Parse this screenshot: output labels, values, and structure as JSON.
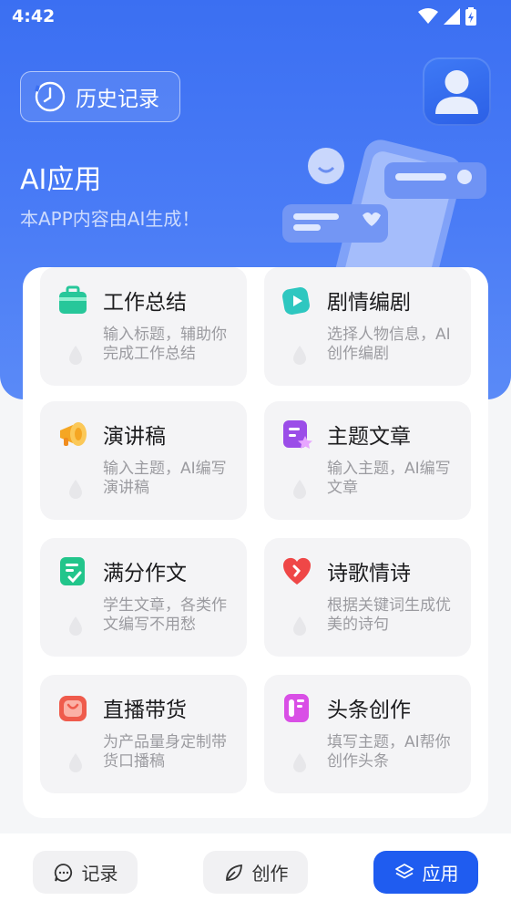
{
  "status_bar": {
    "time": "4:42"
  },
  "header": {
    "history_label": "历史记录",
    "title": "AI应用",
    "subtitle": "本APP内容由AI生成！"
  },
  "apps": [
    {
      "title": "工作总结",
      "desc": "输入标题，辅助你完成工作总结",
      "icon": "briefcase-icon"
    },
    {
      "title": "剧情编剧",
      "desc": "选择人物信息，AI创作编剧",
      "icon": "video-icon"
    },
    {
      "title": "演讲稿",
      "desc": "输入主题，AI编写演讲稿",
      "icon": "megaphone-icon"
    },
    {
      "title": "主题文章",
      "desc": "输入主题，AI编写文章",
      "icon": "article-icon"
    },
    {
      "title": "满分作文",
      "desc": "学生文章，各类作文编写不用愁",
      "icon": "essay-icon"
    },
    {
      "title": "诗歌情诗",
      "desc": "根据关键词生成优美的诗句",
      "icon": "heart-icon"
    },
    {
      "title": "直播带货",
      "desc": "为产品量身定制带货口播稿",
      "icon": "shopping-bag-icon"
    },
    {
      "title": "头条创作",
      "desc": "填写主题，AI帮你创作头条",
      "icon": "headline-icon"
    }
  ],
  "bottom_nav": [
    {
      "label": "记录",
      "icon": "chat-icon",
      "active": false
    },
    {
      "label": "创作",
      "icon": "leaf-icon",
      "active": false
    },
    {
      "label": "应用",
      "icon": "layers-icon",
      "active": true
    }
  ],
  "colors": {
    "primary": "#1f5cf0",
    "hero": "#3b6ff2",
    "tile_bg": "#f4f4f6"
  }
}
